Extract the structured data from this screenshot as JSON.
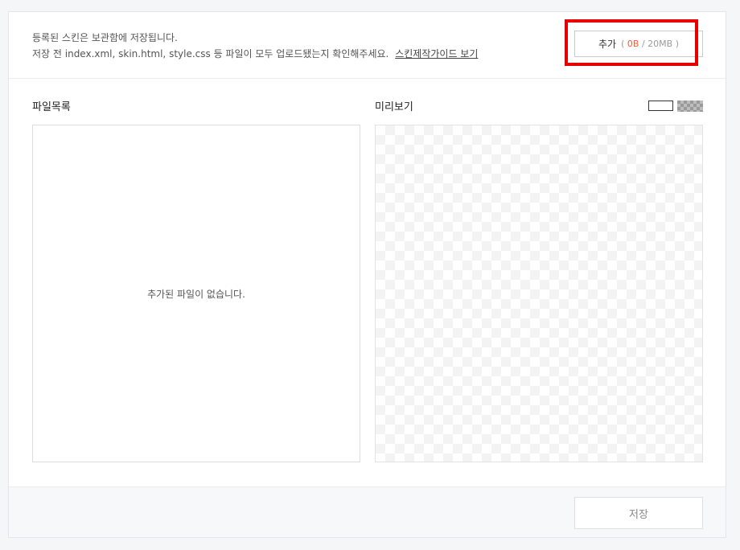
{
  "info": {
    "line1": "등록된 스킨은 보관함에 저장됩니다.",
    "line2": "저장 전 index.xml, skin.html, style.css 등 파일이 모두 업로드됐는지 확인해주세요.",
    "guide_link": "스킨제작가이드 보기"
  },
  "add_button": {
    "label": "추가",
    "open": "(",
    "used": "0B",
    "sep": "/",
    "limit": "20MB",
    "close": ")"
  },
  "file_list": {
    "title": "파일목록",
    "empty_message": "추가된 파일이 없습니다."
  },
  "preview": {
    "title": "미리보기"
  },
  "footer": {
    "save_label": "저장"
  },
  "colors": {
    "highlight": "#e60000",
    "used_size": "#ff5a36"
  }
}
